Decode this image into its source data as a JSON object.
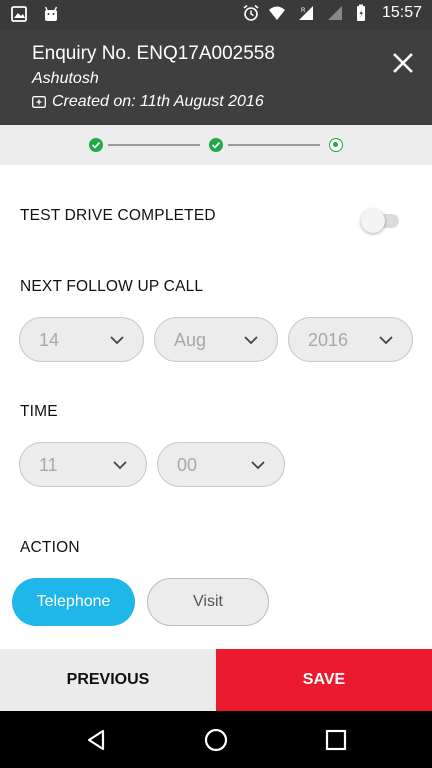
{
  "status_bar": {
    "time": "15:57",
    "icons": [
      "image-icon",
      "android-icon",
      "alarm-icon",
      "wifi-icon",
      "signal-icon",
      "battery-icon"
    ],
    "roaming_label": "R"
  },
  "header": {
    "title": "Enquiry No. ENQ17A002558",
    "customer_name": "Ashutosh",
    "created": "Created on: 11th August 2016",
    "close_icon": "close-icon"
  },
  "stepper": {
    "steps": [
      "done",
      "done",
      "current"
    ],
    "accent_color": "#20a84a"
  },
  "form": {
    "test_drive_label": "TEST DRIVE COMPLETED",
    "test_drive_on": false,
    "follow_up_label": "NEXT FOLLOW UP CALL",
    "follow_up": {
      "day": "14",
      "month": "Aug",
      "year": "2016"
    },
    "time_label": "TIME",
    "time": {
      "hour": "11",
      "minute": "00"
    },
    "action_label": "ACTION",
    "actions": [
      {
        "label": "Telephone",
        "selected": true
      },
      {
        "label": "Visit",
        "selected": false
      }
    ],
    "accent_color": "#1fb6ea"
  },
  "footer": {
    "previous_label": "PREVIOUS",
    "save_label": "SAVE",
    "save_color": "#ec1a2e"
  },
  "nav_bar": {
    "icons": [
      "back-icon",
      "home-icon",
      "recents-icon"
    ]
  }
}
